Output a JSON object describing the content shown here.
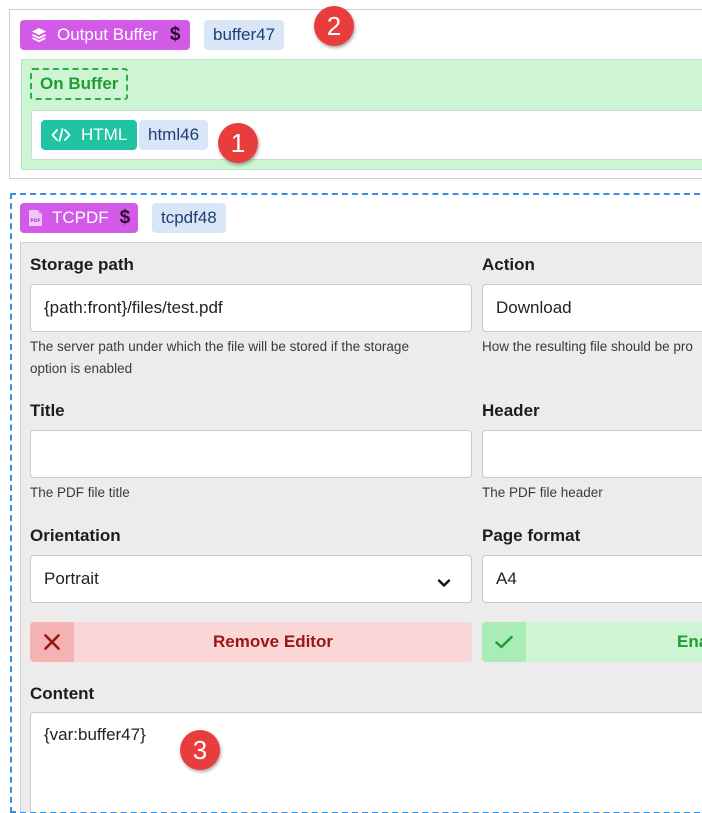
{
  "output_buffer": {
    "type_label": "Output Buffer",
    "dollar": "$",
    "id": "buffer47",
    "on_buffer_label": "On Buffer",
    "child": {
      "type_label": "HTML",
      "id": "html46"
    }
  },
  "badges": {
    "one": "1",
    "two": "2",
    "three": "3"
  },
  "tcpdf": {
    "type_label": "TCPDF",
    "dollar": "$",
    "id": "tcpdf48",
    "storage_path": {
      "label": "Storage path",
      "value": "{path:front}/files/test.pdf",
      "help_line1": "The server path under which the file will be stored if the storage",
      "help_line2": "option is enabled"
    },
    "action": {
      "label": "Action",
      "value": "Download",
      "help": "How the resulting file should be pro"
    },
    "title": {
      "label": "Title",
      "value": "",
      "help": "The PDF file title"
    },
    "header": {
      "label": "Header",
      "value": "",
      "help": "The PDF file header"
    },
    "orientation": {
      "label": "Orientation",
      "value": "Portrait"
    },
    "page_format": {
      "label": "Page format",
      "value": "A4"
    },
    "remove_editor_label": "Remove Editor",
    "enable_label": "Ena",
    "content": {
      "label": "Content",
      "value": "{var:buffer47}"
    }
  },
  "colors": {
    "buffer_type": "#d25ae6",
    "id_tag": "#d8e6f8",
    "html_type": "#20c4a2",
    "on_buffer_zone": "#cdf5d3",
    "badge": "#e93c3c",
    "remove_bg": "#fbd6d6",
    "enable_bg": "#cdf5d3"
  }
}
